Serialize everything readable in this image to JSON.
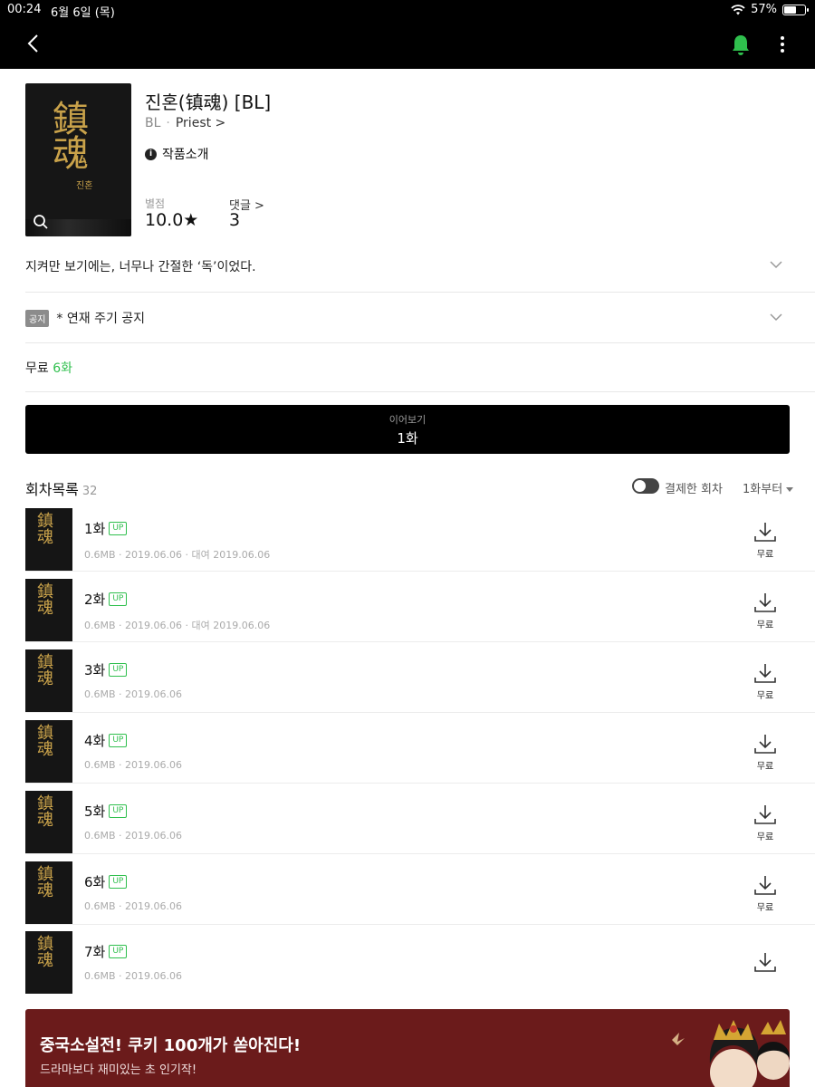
{
  "status_bar": {
    "time": "00:24",
    "date": "6월 6일 (목)",
    "battery": "57%"
  },
  "book": {
    "title": "진혼(镇魂) [BL]",
    "genre": "BL",
    "author": "Priest >",
    "intro_label": "작품소개",
    "cover_art": "鎮魂",
    "cover_small": "진혼",
    "rating_label": "별점",
    "rating_value": "10.0★",
    "comment_label": "댓글 >",
    "comment_value": "3"
  },
  "tagline": "지켜만 보기에는, 너무나 간절한 ‘독’이었다.",
  "notice": {
    "badge": "공지",
    "text": "* 연재 주기 공지"
  },
  "free": {
    "label": "무료",
    "count": "6화"
  },
  "continue": {
    "sub": "이어보기",
    "main": "1화"
  },
  "episode_list": {
    "title": "회차목록",
    "count": "32",
    "toggle_label": "결제한 회차",
    "sort_label": "1화부터"
  },
  "episodes": [
    {
      "title": "1화",
      "badge": "UP",
      "meta": "0.6MB · 2019.06.06 · 대여 2019.06.06",
      "price": "무료"
    },
    {
      "title": "2화",
      "badge": "UP",
      "meta": "0.6MB · 2019.06.06 · 대여 2019.06.06",
      "price": "무료"
    },
    {
      "title": "3화",
      "badge": "UP",
      "meta": "0.6MB · 2019.06.06",
      "price": "무료"
    },
    {
      "title": "4화",
      "badge": "UP",
      "meta": "0.6MB · 2019.06.06",
      "price": "무료"
    },
    {
      "title": "5화",
      "badge": "UP",
      "meta": "0.6MB · 2019.06.06",
      "price": "무료"
    },
    {
      "title": "6화",
      "badge": "UP",
      "meta": "0.6MB · 2019.06.06",
      "price": "무료"
    },
    {
      "title": "7화",
      "badge": "UP",
      "meta": "0.6MB · 2019.06.06",
      "price": ""
    }
  ],
  "banner": {
    "title": "중국소설전! 쿠키 100개가 쏟아진다!",
    "subtitle": "드라마보다 재미있는 초 인기작!"
  },
  "colors": {
    "accent_green": "#2fbf4d",
    "banner_bg": "#6b1b1b",
    "topbar_bg": "#000000"
  }
}
